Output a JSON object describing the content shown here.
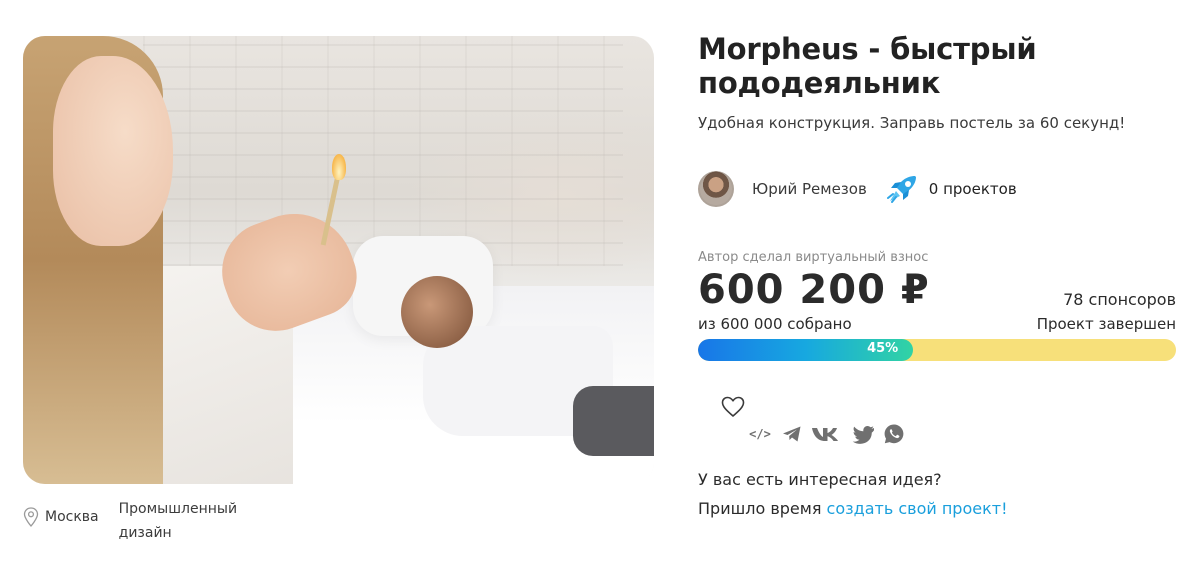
{
  "project": {
    "title": "Morpheus - быстрый пододеяльник",
    "subtitle": "Удобная конструкция. Заправь постель за 60 секунд!",
    "image_alt": "project-cover-photo"
  },
  "meta": {
    "location": "Москва",
    "category": "Промышленный дизайн",
    "location_icon": "map-pin-icon"
  },
  "author": {
    "name": "Юрий Ремезов",
    "projects_label": "0 проектов",
    "rocket_icon": "rocket-icon"
  },
  "funding": {
    "note": "Автор сделал виртуальный взнос",
    "amount": "600 200 ₽",
    "goal_label": "из 600 000 собрано",
    "sponsors_label": "78 спонсоров",
    "status_label": "Проект завершен",
    "progress_percent": 45,
    "progress_label": "45%",
    "colors": {
      "fill_start": "#1876e8",
      "fill_end": "#31d3a4",
      "track": "#f7e07a"
    }
  },
  "share": {
    "icons": [
      "embed-code-icon",
      "telegram-icon",
      "vk-icon",
      "twitter-icon",
      "whatsapp-icon"
    ],
    "embed_label": "</>"
  },
  "cta": {
    "question": "У вас есть интересная идея?",
    "prefix": "Пришло время ",
    "link": "создать свой проект!",
    "link_color": "#1a9fdc"
  }
}
